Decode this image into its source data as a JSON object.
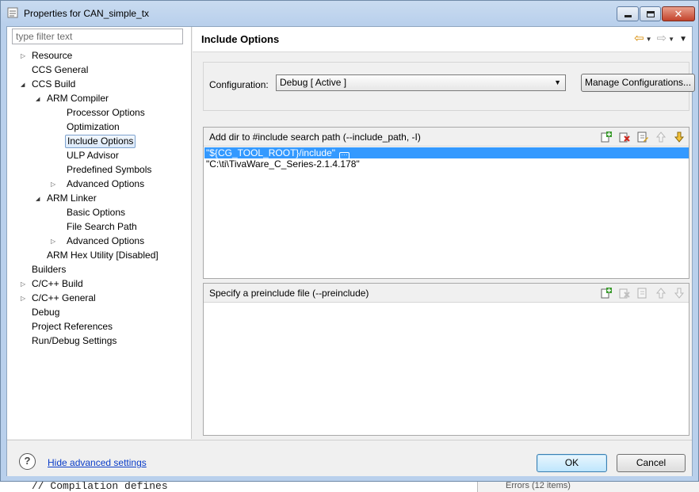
{
  "window": {
    "title": "Properties for CAN_simple_tx"
  },
  "filter": {
    "placeholder": "type filter text",
    "value": ""
  },
  "tree": [
    {
      "label": "Resource",
      "level": 0,
      "twisty": "closed"
    },
    {
      "label": "CCS General",
      "level": 0,
      "twisty": "none"
    },
    {
      "label": "CCS Build",
      "level": 0,
      "twisty": "open"
    },
    {
      "label": "ARM Compiler",
      "level": 1,
      "twisty": "open"
    },
    {
      "label": "Processor Options",
      "level": 2,
      "twisty": "none"
    },
    {
      "label": "Optimization",
      "level": 2,
      "twisty": "none"
    },
    {
      "label": "Include Options",
      "level": 2,
      "twisty": "none",
      "selected": true
    },
    {
      "label": "ULP Advisor",
      "level": 2,
      "twisty": "none"
    },
    {
      "label": "Predefined Symbols",
      "level": 2,
      "twisty": "none"
    },
    {
      "label": "Advanced Options",
      "level": 2,
      "twisty": "closed"
    },
    {
      "label": "ARM Linker",
      "level": 1,
      "twisty": "open"
    },
    {
      "label": "Basic Options",
      "level": 2,
      "twisty": "none"
    },
    {
      "label": "File Search Path",
      "level": 2,
      "twisty": "none"
    },
    {
      "label": "Advanced Options",
      "level": 2,
      "twisty": "closed"
    },
    {
      "label": "ARM Hex Utility  [Disabled]",
      "level": 1,
      "twisty": "none"
    },
    {
      "label": "Builders",
      "level": 0,
      "twisty": "none"
    },
    {
      "label": "C/C++ Build",
      "level": 0,
      "twisty": "closed"
    },
    {
      "label": "C/C++ General",
      "level": 0,
      "twisty": "closed"
    },
    {
      "label": "Debug",
      "level": 0,
      "twisty": "none"
    },
    {
      "label": "Project References",
      "level": 0,
      "twisty": "none"
    },
    {
      "label": "Run/Debug Settings",
      "level": 0,
      "twisty": "none"
    }
  ],
  "page": {
    "title": "Include Options"
  },
  "configuration": {
    "label": "Configuration:",
    "value": "Debug  [ Active ]",
    "manage_label": "Manage Configurations..."
  },
  "include_panel": {
    "title": "Add dir to #include search path (--include_path, -I)",
    "items": [
      "\"${CG_TOOL_ROOT}/include\"",
      "\"C:\\ti\\TivaWare_C_Series-2.1.4.178\""
    ]
  },
  "preinclude_panel": {
    "title": "Specify a preinclude file (--preinclude)",
    "items": []
  },
  "footer": {
    "help_glyph": "?",
    "advanced_link": "Hide advanced settings",
    "ok_label": "OK",
    "cancel_label": "Cancel"
  },
  "background": {
    "code_fragment": "// Compilation defines",
    "status_fragment": "Errors (12 items)"
  },
  "colors": {
    "selection": "#3399ff",
    "link": "#0a3cc8",
    "title_gradient": "#c9dbf0"
  }
}
